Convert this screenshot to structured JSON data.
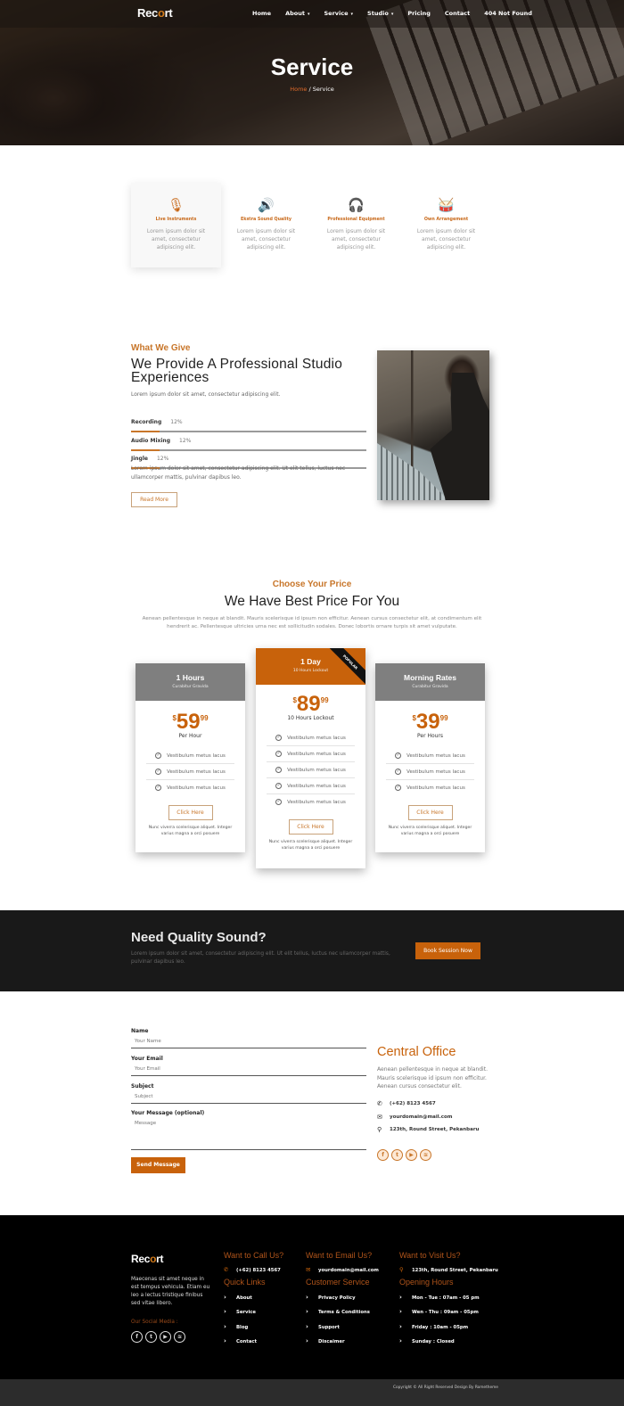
{
  "brand": {
    "logo_pre": "Rec",
    "logo_accent": "o",
    "logo_post": "rt",
    "accent_color": "#c8620b"
  },
  "nav": {
    "items": [
      {
        "label": "Home",
        "dropdown": false
      },
      {
        "label": "About",
        "dropdown": true
      },
      {
        "label": "Service",
        "dropdown": true
      },
      {
        "label": "Studio",
        "dropdown": true
      },
      {
        "label": "Pricing",
        "dropdown": false
      },
      {
        "label": "Contact",
        "dropdown": false
      },
      {
        "label": "404 Not Found",
        "dropdown": false
      }
    ],
    "caret": "▾"
  },
  "hero": {
    "title": "Service",
    "breadcrumb": {
      "home": "Home",
      "separator": " / ",
      "current": "Service"
    }
  },
  "features": [
    {
      "icon": "microphone-icon",
      "glyph": "🎙",
      "title": "Live Instruments",
      "text": "Lorem ipsum dolor sit amet, consectetur adipiscing elit."
    },
    {
      "icon": "speaker-icon",
      "glyph": "🔊",
      "title": "Ekstra Sound Quality",
      "text": "Lorem ipsum dolor sit amet, consectetur adipiscing elit."
    },
    {
      "icon": "headphones-icon",
      "glyph": "🎧",
      "title": "Professional Equipment",
      "text": "Lorem ipsum dolor sit amet, consectetur adipiscing elit."
    },
    {
      "icon": "drum-icon",
      "glyph": "🥁",
      "title": "Own Arrangement",
      "text": "Lorem ipsum dolor sit amet, consectetur adipiscing elit."
    }
  ],
  "about": {
    "subtitle": "What We Give",
    "title": "We Provide A Professional Studio Experiences",
    "lead": "Lorem ipsum dolor sit amet, consectetur adipiscing elit.",
    "skills": [
      {
        "label": "Recording",
        "percent": 12,
        "percent_label": "12%"
      },
      {
        "label": "Audio Mixing",
        "percent": 12,
        "percent_label": "12%"
      },
      {
        "label": "Jingle",
        "percent": 12,
        "percent_label": "12%"
      }
    ],
    "body": "Lorem ipsum dolor sit amet, consectetur adipiscing elit. Ut elit tellus, luctus nec ullamcorper mattis, pulvinar dapibus leo.",
    "button": "Read More"
  },
  "pricing": {
    "subtitle": "Choose Your Price",
    "title": "We Have Best Price For You",
    "lead": "Aenean pellentesque in neque at blandit. Mauris scelerisque id ipsum non efficitur. Aenean cursus consectetur elit, at condimentum elit hendrerit ac. Pellentesque ultricies urna nec est sollicitudin sodales. Donec lobortis ornare turpis sit amet vulputate.",
    "plans": [
      {
        "name": "1 Hours",
        "subtitle": "Curabitur Gravida",
        "currency": "$",
        "price": "59",
        "cents": "99",
        "period": "Per Hour",
        "features": [
          "Vestibulum metus lacus",
          "Vestibulum metus lacus",
          "Vestibulum metus lacus"
        ],
        "button": "Click Here",
        "note": "Nunc viverra scelerisque aliquet. Integer varius magna a orci posuere",
        "popular": false
      },
      {
        "name": "1 Day",
        "subtitle": "10 Hours Lockout",
        "currency": "$",
        "price": "89",
        "cents": "99",
        "period": "10 Hours Lockout",
        "features": [
          "Vestibulum metus lacus",
          "Vestibulum metus lacus",
          "Vestibulum metus lacus",
          "Vestibulum metus lacus",
          "Vestibulum metus lacus"
        ],
        "button": "Click Here",
        "note": "Nunc viverra scelerisque aliquet. Integer varius magna a orci posuere",
        "popular": true,
        "badge": "POPULAR"
      },
      {
        "name": "Morning Rates",
        "subtitle": "Curabitur Gravida",
        "currency": "$",
        "price": "39",
        "cents": "99",
        "period": "Per Hours",
        "features": [
          "Vestibulum metus lacus",
          "Vestibulum metus lacus",
          "Vestibulum metus lacus"
        ],
        "button": "Click Here",
        "note": "Nunc viverra scelerisque aliquet. Integer varius magna a orci posuere",
        "popular": false
      }
    ]
  },
  "cta": {
    "title": "Need Quality Sound?",
    "text": "Lorem ipsum dolor sit amet, consectetur adipiscing elit. Ut elit tellus, luctus nec ullamcorper mattis, pulvinar dapibus leo.",
    "button": "Book Session Now"
  },
  "contact_form": {
    "fields": [
      {
        "label": "Name",
        "placeholder": "Your Name",
        "value": ""
      },
      {
        "label": "Your Email",
        "placeholder": "Your Email",
        "value": ""
      },
      {
        "label": "Subject",
        "placeholder": "Subject",
        "value": ""
      },
      {
        "label": "Your Message (optional)",
        "placeholder": "Message",
        "value": ""
      }
    ],
    "submit": "Send Message"
  },
  "office": {
    "title": "Central Office",
    "text": "Aenean pellentesque in neque at blandit. Mauris scelerisque id ipsum non efficitur. Aenean cursus consectetur elit.",
    "phone": "(+62) 8123 4567",
    "email": "yourdomain@mail.com",
    "address": "123th, Round Street, Pekanbaru",
    "socials": [
      "facebook-icon",
      "twitter-icon",
      "youtube-icon",
      "spotify-icon"
    ]
  },
  "footer": {
    "about": "Maecenas sit amet neque in est tempus vehicula. Etiam eu leo a lectus tristique finibus sed vitae libero.",
    "social_label": "Our Social Media :",
    "call": {
      "heading": "Want to Call Us?",
      "value": "(+62) 8123 4567"
    },
    "email": {
      "heading": "Want to Email Us?",
      "value": "yourdomain@mail.com"
    },
    "visit": {
      "heading": "Want to Visit Us?",
      "value": "123th, Round Street, Pekanbaru"
    },
    "quick_links": {
      "heading": "Quick Links",
      "items": [
        "About",
        "Service",
        "Blog",
        "Contact"
      ]
    },
    "customer_service": {
      "heading": "Customer Service",
      "items": [
        "Privacy Policy",
        "Terms & Conditions",
        "Support",
        "Discaimer"
      ]
    },
    "opening_hours": {
      "heading": "Opening Hours",
      "items": [
        "Mon - Tue : 07am - 05 pm",
        "Wen - Thu : 09am - 05pm",
        "Friday : 10am - 05pm",
        "Sunday : Closed"
      ]
    },
    "copyright": "Copyright © All Right Reserved Design By Rometheme"
  }
}
